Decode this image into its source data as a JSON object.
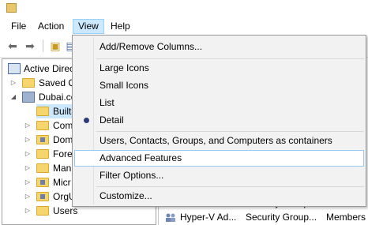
{
  "menubar": {
    "items": [
      "File",
      "Action",
      "View",
      "Help"
    ]
  },
  "tree": {
    "items": [
      {
        "label": "Active Directo"
      },
      {
        "label": "Saved Q"
      },
      {
        "label": "Dubai.co"
      },
      {
        "label": "Built"
      },
      {
        "label": "Com"
      },
      {
        "label": "Dom"
      },
      {
        "label": "Fore"
      },
      {
        "label": "Man"
      },
      {
        "label": "Micr"
      },
      {
        "label": "OrgU"
      },
      {
        "label": "Users"
      }
    ]
  },
  "list": {
    "rows": [
      {
        "name": "Hyper-V Ad...",
        "type": "Security Group...",
        "desc": "Members of"
      }
    ],
    "partial_row": {
      "name": "...",
      "type": "Security Group...",
      "desc": ""
    }
  },
  "view_menu": {
    "items": [
      {
        "label": "Add/Remove Columns..."
      },
      {
        "label": "Large Icons"
      },
      {
        "label": "Small Icons"
      },
      {
        "label": "List"
      },
      {
        "label": "Detail",
        "selected": true
      },
      {
        "label": "Users, Contacts, Groups, and Computers as containers"
      },
      {
        "label": "Advanced Features",
        "highlighted": true
      },
      {
        "label": "Filter Options..."
      },
      {
        "label": "Customize..."
      }
    ]
  },
  "colors": {
    "menu_active_bg": "#cce8ff",
    "menu_hover_border": "#99c9f2",
    "radio_dot": "#2b3c78"
  }
}
